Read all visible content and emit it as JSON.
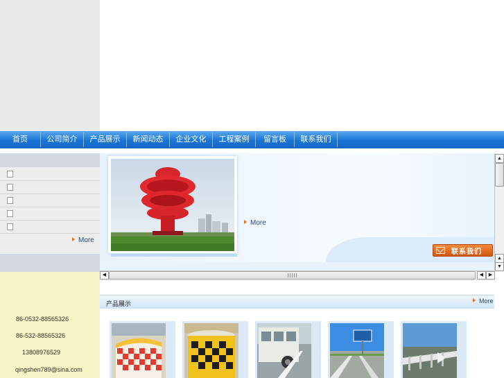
{
  "nav": {
    "items": [
      {
        "label": "首页"
      },
      {
        "label": "公司简介"
      },
      {
        "label": "产品展示"
      },
      {
        "label": "新闻动态"
      },
      {
        "label": "企业文化"
      },
      {
        "label": "工程案例"
      },
      {
        "label": "留言板"
      },
      {
        "label": "联系我们"
      }
    ]
  },
  "sidebar": {
    "more_label": "More"
  },
  "contact": {
    "phone_1": "86-0532-88565326",
    "phone_2": "86-532-88565326",
    "mobile": "13808976529",
    "email": "qingshen789@sina.com"
  },
  "feature": {
    "more_label": "More",
    "contact_button_label": "联系我们"
  },
  "products": {
    "title": "产品展示",
    "more_label": "More"
  },
  "colors": {
    "nav_blue": "#1a75d6",
    "accent_orange": "#e8701a",
    "contact_bg": "#f8f3c4"
  }
}
